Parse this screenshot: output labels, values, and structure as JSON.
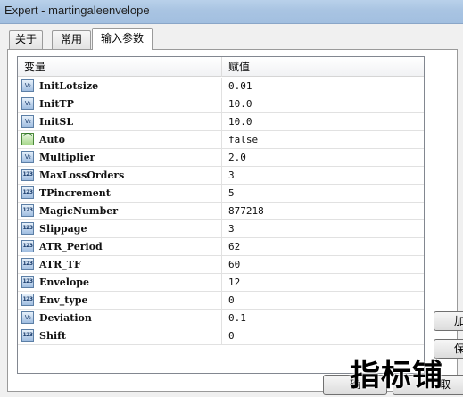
{
  "window": {
    "title": "Expert - martingaleenvelope"
  },
  "tabs": [
    {
      "label": "关于"
    },
    {
      "label": "常用"
    },
    {
      "label": "输入参数",
      "active": true
    }
  ],
  "table": {
    "headers": {
      "variable": "变量",
      "value": "赋值"
    },
    "rows": [
      {
        "icon": "double-type-icon",
        "name": "InitLotsize",
        "value": "0.01"
      },
      {
        "icon": "double-type-icon",
        "name": "InitTP",
        "value": "10.0"
      },
      {
        "icon": "double-type-icon",
        "name": "InitSL",
        "value": "10.0"
      },
      {
        "icon": "bool-type-icon",
        "name": "Auto",
        "value": "false"
      },
      {
        "icon": "double-type-icon",
        "name": "Multiplier",
        "value": "2.0"
      },
      {
        "icon": "int-type-icon",
        "name": "MaxLossOrders",
        "value": "3"
      },
      {
        "icon": "int-type-icon",
        "name": "TPincrement",
        "value": "5"
      },
      {
        "icon": "int-type-icon",
        "name": "MagicNumber",
        "value": "877218"
      },
      {
        "icon": "int-type-icon",
        "name": "Slippage",
        "value": "3"
      },
      {
        "icon": "int-type-icon",
        "name": "ATR_Period",
        "value": "62"
      },
      {
        "icon": "int-type-icon",
        "name": "ATR_TF",
        "value": "60"
      },
      {
        "icon": "int-type-icon",
        "name": "Envelope",
        "value": "12"
      },
      {
        "icon": "int-type-icon",
        "name": "Env_type",
        "value": "0"
      },
      {
        "icon": "double-type-icon",
        "name": "Deviation",
        "value": "0.1"
      },
      {
        "icon": "int-type-icon",
        "name": "Shift",
        "value": "0"
      }
    ]
  },
  "icon_glyphs": {
    "double": "V₂",
    "int": "123",
    "bool": "⌒"
  },
  "buttons": {
    "load_partial": "加",
    "save_partial": "保",
    "ok_partial": "确",
    "cancel_partial": "取"
  },
  "watermark": {
    "text": "指标铺"
  },
  "colors": {
    "titlebar": "#a9c4e2",
    "window_bg": "#f0f0f0",
    "list_bg": "#ffffff"
  }
}
